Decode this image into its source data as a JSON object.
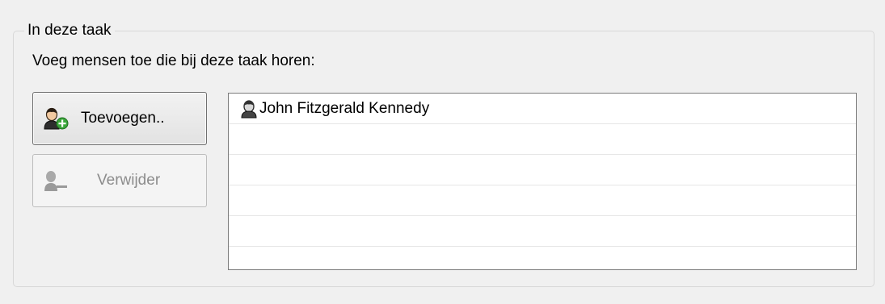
{
  "group": {
    "title": "In deze taak",
    "instruction": "Voeg mensen toe die bij deze taak horen:"
  },
  "buttons": {
    "add": {
      "label": "Toevoegen..",
      "icon": "add-person-icon",
      "enabled": true
    },
    "remove": {
      "label": "Verwijder",
      "icon": "remove-person-icon",
      "enabled": false
    }
  },
  "people_list": {
    "items": [
      {
        "name": "John Fitzgerald Kennedy",
        "icon": "person-icon"
      },
      {
        "name": ""
      },
      {
        "name": ""
      },
      {
        "name": ""
      },
      {
        "name": ""
      }
    ]
  },
  "colors": {
    "background": "#f0f0f0",
    "list_background": "#ffffff",
    "add_icon_green": "#3aa63a",
    "disabled_text": "#8c8c8c"
  }
}
